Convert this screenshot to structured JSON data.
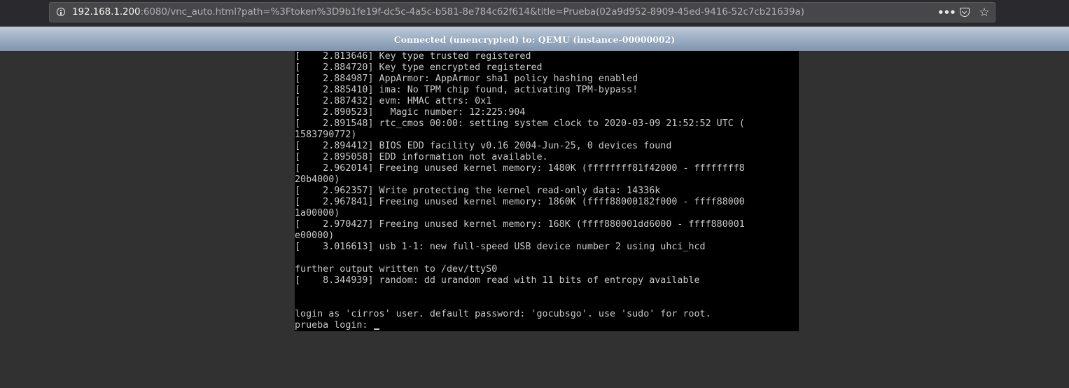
{
  "browser": {
    "url_host": "192.168.1.200",
    "url_rest": ":6080/vnc_auto.html?path=%3Ftoken%3D9b1fe19f-dc5c-4a5c-b581-8e784c62f614&title=Prueba(02a9d952-8909-45ed-9416-52c7cb21639a)",
    "icons": {
      "info": "info-icon",
      "page_actions": "meatball-menu-icon",
      "pocket": "pocket-icon",
      "bookmark": "star-icon"
    },
    "meatball_glyph": "•••",
    "star_glyph": "☆"
  },
  "vnc": {
    "status": "Connected (unencrypted) to: QEMU (instance-00000002)"
  },
  "console": {
    "lines": [
      "[    2.813646] Key type trusted registered",
      "[    2.884720] Key type encrypted registered",
      "[    2.884987] AppArmor: AppArmor sha1 policy hashing enabled",
      "[    2.885410] ima: No TPM chip found, activating TPM-bypass!",
      "[    2.887432] evm: HMAC attrs: 0x1",
      "[    2.890523]   Magic number: 12:225:904",
      "[    2.891548] rtc_cmos 00:00: setting system clock to 2020-03-09 21:52:52 UTC (",
      "1583790772)",
      "[    2.894412] BIOS EDD facility v0.16 2004-Jun-25, 0 devices found",
      "[    2.895058] EDD information not available.",
      "[    2.962014] Freeing unused kernel memory: 1480K (ffffffff81f42000 - ffffffff8",
      "20b4000)",
      "[    2.962357] Write protecting the kernel read-only data: 14336k",
      "[    2.967841] Freeing unused kernel memory: 1860K (ffff88000182f000 - ffff88000",
      "1a00000)",
      "[    2.970427] Freeing unused kernel memory: 168K (ffff880001dd6000 - ffff880001",
      "e00000)",
      "[    3.016613] usb 1-1: new full-speed USB device number 2 using uhci_hcd",
      "",
      "further output written to /dev/ttyS0",
      "[    8.344939] random: dd urandom read with 11 bits of entropy available",
      "",
      "",
      "login as 'cirros' user. default password: 'gocubsgo'. use 'sudo' for root.",
      "prueba login: "
    ]
  }
}
